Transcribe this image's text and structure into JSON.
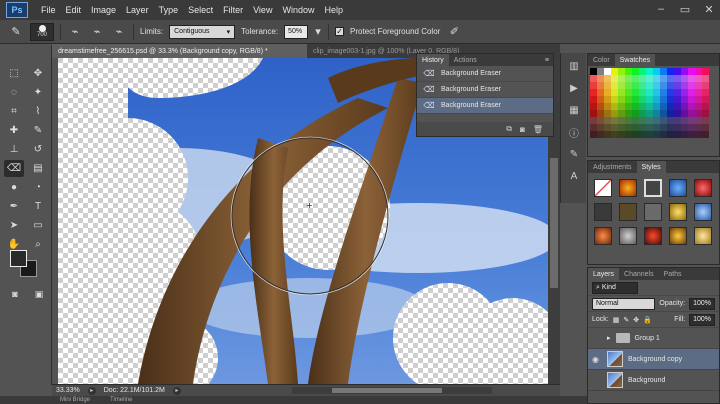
{
  "app": {
    "logo": "Ps"
  },
  "menu": [
    "File",
    "Edit",
    "Image",
    "Layer",
    "Type",
    "Select",
    "Filter",
    "View",
    "Window",
    "Help"
  ],
  "window_controls": {
    "minimize": "–",
    "maximize": "▭",
    "close": "✕"
  },
  "options_bar": {
    "brush_size": "700",
    "limits_label": "Limits:",
    "limits_value": "Contiguous",
    "tolerance_label": "Tolerance:",
    "tolerance_value": "50%",
    "protect_label": "Protect Foreground Color",
    "protect_checked": true
  },
  "tabs": [
    {
      "label": "dreamstimefree_256615.psd @ 33.3% (Background copy, RGB/8) *",
      "active": true
    },
    {
      "label": "clip_image003-1.jpg @ 100% (Layer 0, RGB/8)",
      "active": false
    }
  ],
  "status": {
    "zoom": "33.33%",
    "doc": "Doc: 22.1M/101.2M"
  },
  "bottom": [
    "Mini Bridge",
    "Timeline"
  ],
  "history": {
    "tabs": [
      "History",
      "Actions"
    ],
    "items": [
      {
        "label": "Background Eraser",
        "selected": false
      },
      {
        "label": "Background Eraser",
        "selected": false
      },
      {
        "label": "Background Eraser",
        "selected": true
      }
    ]
  },
  "swatches_panel": {
    "tabs": [
      "Color",
      "Swatches"
    ],
    "active": "Swatches"
  },
  "styles_panel": {
    "tabs": [
      "Adjustments",
      "Styles"
    ],
    "active": "Styles"
  },
  "layers_panel": {
    "tabs": [
      "Layers",
      "Channels",
      "Paths"
    ],
    "kind_label": "Kind",
    "blend_mode": "Normal",
    "opacity_label": "Opacity:",
    "opacity_value": "100%",
    "lock_label": "Lock:",
    "fill_label": "Fill:",
    "fill_value": "100%",
    "layers": [
      {
        "name": "Group 1",
        "type": "group",
        "selected": false
      },
      {
        "name": "Background copy",
        "type": "image",
        "selected": true
      },
      {
        "name": "Background",
        "type": "image",
        "selected": false
      }
    ]
  },
  "colors": {
    "accent_selected": "#5c6c84",
    "sky": "#3d6fd1",
    "rust": "#7a5230"
  }
}
